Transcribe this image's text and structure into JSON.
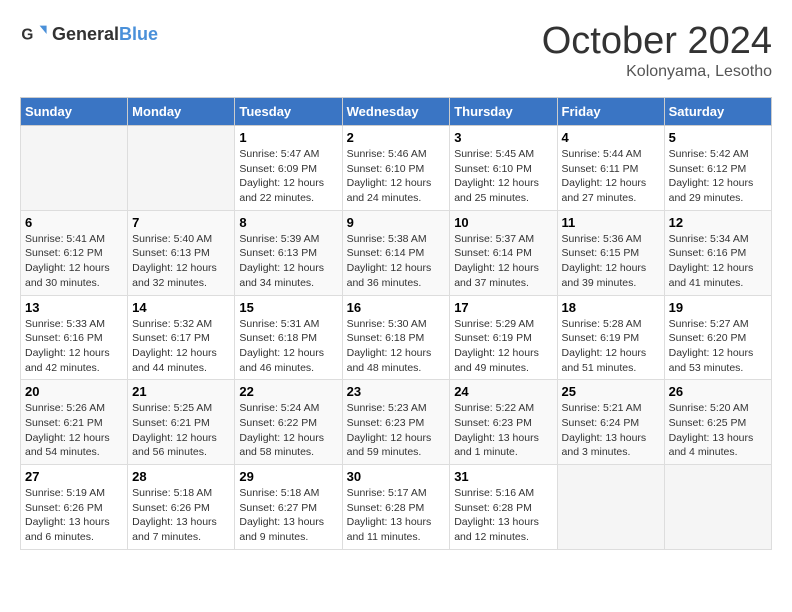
{
  "header": {
    "logo_general": "General",
    "logo_blue": "Blue",
    "month": "October 2024",
    "location": "Kolonyama, Lesotho"
  },
  "days_of_week": [
    "Sunday",
    "Monday",
    "Tuesday",
    "Wednesday",
    "Thursday",
    "Friday",
    "Saturday"
  ],
  "weeks": [
    [
      {
        "day": "",
        "info": ""
      },
      {
        "day": "",
        "info": ""
      },
      {
        "day": "1",
        "sunrise": "5:47 AM",
        "sunset": "6:09 PM",
        "daylight": "12 hours and 22 minutes."
      },
      {
        "day": "2",
        "sunrise": "5:46 AM",
        "sunset": "6:10 PM",
        "daylight": "12 hours and 24 minutes."
      },
      {
        "day": "3",
        "sunrise": "5:45 AM",
        "sunset": "6:10 PM",
        "daylight": "12 hours and 25 minutes."
      },
      {
        "day": "4",
        "sunrise": "5:44 AM",
        "sunset": "6:11 PM",
        "daylight": "12 hours and 27 minutes."
      },
      {
        "day": "5",
        "sunrise": "5:42 AM",
        "sunset": "6:12 PM",
        "daylight": "12 hours and 29 minutes."
      }
    ],
    [
      {
        "day": "6",
        "sunrise": "5:41 AM",
        "sunset": "6:12 PM",
        "daylight": "12 hours and 30 minutes."
      },
      {
        "day": "7",
        "sunrise": "5:40 AM",
        "sunset": "6:13 PM",
        "daylight": "12 hours and 32 minutes."
      },
      {
        "day": "8",
        "sunrise": "5:39 AM",
        "sunset": "6:13 PM",
        "daylight": "12 hours and 34 minutes."
      },
      {
        "day": "9",
        "sunrise": "5:38 AM",
        "sunset": "6:14 PM",
        "daylight": "12 hours and 36 minutes."
      },
      {
        "day": "10",
        "sunrise": "5:37 AM",
        "sunset": "6:14 PM",
        "daylight": "12 hours and 37 minutes."
      },
      {
        "day": "11",
        "sunrise": "5:36 AM",
        "sunset": "6:15 PM",
        "daylight": "12 hours and 39 minutes."
      },
      {
        "day": "12",
        "sunrise": "5:34 AM",
        "sunset": "6:16 PM",
        "daylight": "12 hours and 41 minutes."
      }
    ],
    [
      {
        "day": "13",
        "sunrise": "5:33 AM",
        "sunset": "6:16 PM",
        "daylight": "12 hours and 42 minutes."
      },
      {
        "day": "14",
        "sunrise": "5:32 AM",
        "sunset": "6:17 PM",
        "daylight": "12 hours and 44 minutes."
      },
      {
        "day": "15",
        "sunrise": "5:31 AM",
        "sunset": "6:18 PM",
        "daylight": "12 hours and 46 minutes."
      },
      {
        "day": "16",
        "sunrise": "5:30 AM",
        "sunset": "6:18 PM",
        "daylight": "12 hours and 48 minutes."
      },
      {
        "day": "17",
        "sunrise": "5:29 AM",
        "sunset": "6:19 PM",
        "daylight": "12 hours and 49 minutes."
      },
      {
        "day": "18",
        "sunrise": "5:28 AM",
        "sunset": "6:19 PM",
        "daylight": "12 hours and 51 minutes."
      },
      {
        "day": "19",
        "sunrise": "5:27 AM",
        "sunset": "6:20 PM",
        "daylight": "12 hours and 53 minutes."
      }
    ],
    [
      {
        "day": "20",
        "sunrise": "5:26 AM",
        "sunset": "6:21 PM",
        "daylight": "12 hours and 54 minutes."
      },
      {
        "day": "21",
        "sunrise": "5:25 AM",
        "sunset": "6:21 PM",
        "daylight": "12 hours and 56 minutes."
      },
      {
        "day": "22",
        "sunrise": "5:24 AM",
        "sunset": "6:22 PM",
        "daylight": "12 hours and 58 minutes."
      },
      {
        "day": "23",
        "sunrise": "5:23 AM",
        "sunset": "6:23 PM",
        "daylight": "12 hours and 59 minutes."
      },
      {
        "day": "24",
        "sunrise": "5:22 AM",
        "sunset": "6:23 PM",
        "daylight": "13 hours and 1 minute."
      },
      {
        "day": "25",
        "sunrise": "5:21 AM",
        "sunset": "6:24 PM",
        "daylight": "13 hours and 3 minutes."
      },
      {
        "day": "26",
        "sunrise": "5:20 AM",
        "sunset": "6:25 PM",
        "daylight": "13 hours and 4 minutes."
      }
    ],
    [
      {
        "day": "27",
        "sunrise": "5:19 AM",
        "sunset": "6:26 PM",
        "daylight": "13 hours and 6 minutes."
      },
      {
        "day": "28",
        "sunrise": "5:18 AM",
        "sunset": "6:26 PM",
        "daylight": "13 hours and 7 minutes."
      },
      {
        "day": "29",
        "sunrise": "5:18 AM",
        "sunset": "6:27 PM",
        "daylight": "13 hours and 9 minutes."
      },
      {
        "day": "30",
        "sunrise": "5:17 AM",
        "sunset": "6:28 PM",
        "daylight": "13 hours and 11 minutes."
      },
      {
        "day": "31",
        "sunrise": "5:16 AM",
        "sunset": "6:28 PM",
        "daylight": "13 hours and 12 minutes."
      },
      {
        "day": "",
        "info": ""
      },
      {
        "day": "",
        "info": ""
      }
    ]
  ]
}
